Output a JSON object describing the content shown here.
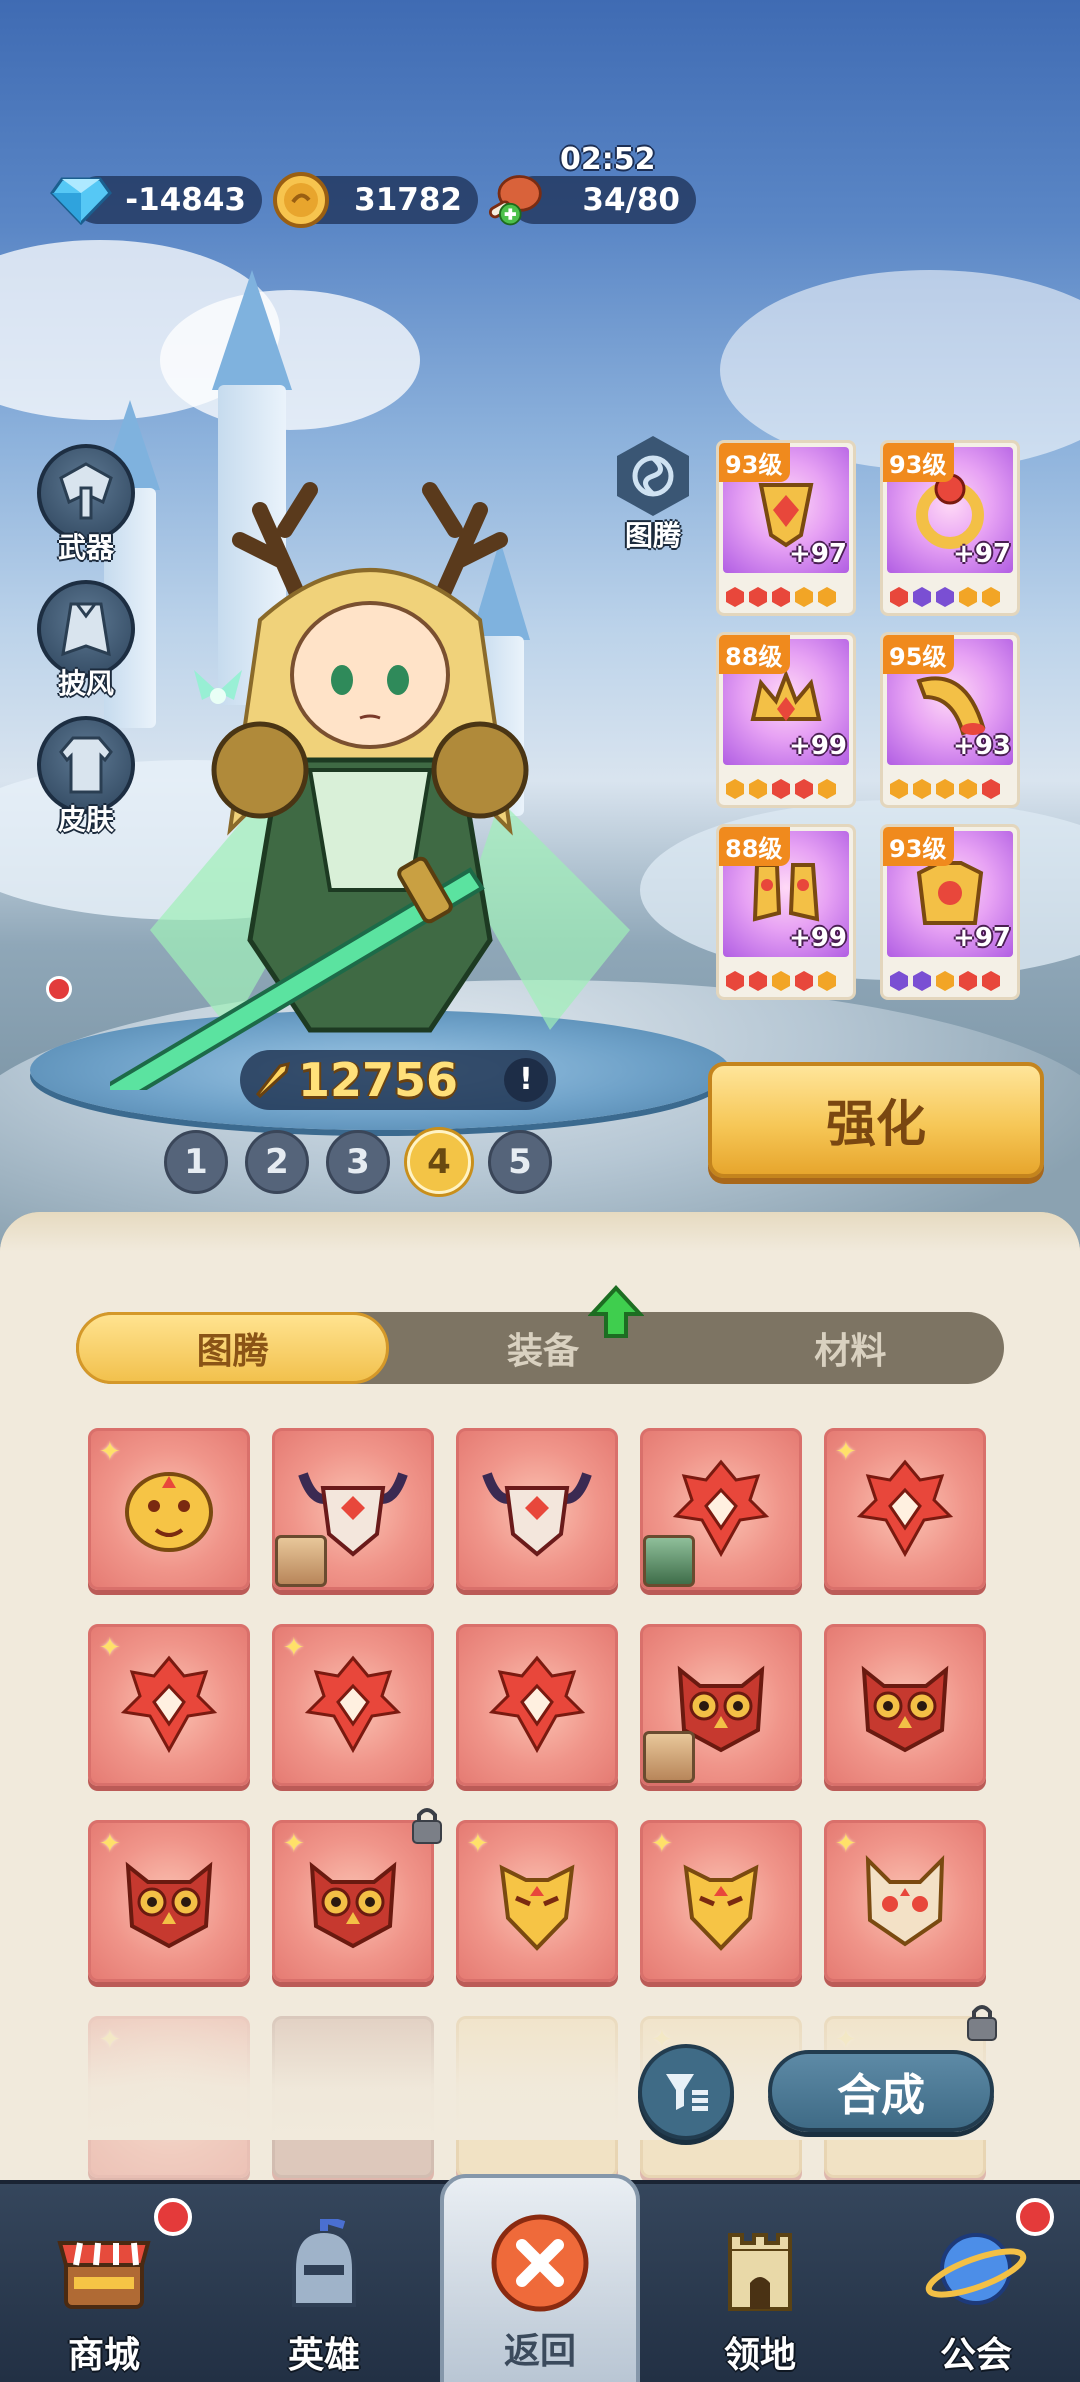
{
  "resources": {
    "timer": "02:52",
    "diamonds": "-14843",
    "gold": "31782",
    "stamina": "34/80"
  },
  "side_buttons": [
    {
      "label": "武器",
      "icon": "weapon-icon"
    },
    {
      "label": "披风",
      "icon": "cape-icon"
    },
    {
      "label": "皮肤",
      "icon": "skin-icon"
    }
  ],
  "hero": {
    "power": "12756",
    "info_mark": "!",
    "pages": [
      "1",
      "2",
      "3",
      "4",
      "5"
    ],
    "active_page": "4"
  },
  "totem_button": {
    "label": "图腾",
    "icon": "totem-icon"
  },
  "equipment": [
    {
      "level": "93级",
      "plus": "+97",
      "gems": [
        "#e8473b",
        "#e8473b",
        "#e8473b",
        "#f2a526",
        "#f2a526"
      ]
    },
    {
      "level": "93级",
      "plus": "+97",
      "gems": [
        "#e8473b",
        "#7a4fd3",
        "#7a4fd3",
        "#f2a526",
        "#f2a526"
      ]
    },
    {
      "level": "88级",
      "plus": "+99",
      "gems": [
        "#f2a526",
        "#f2a526",
        "#e8473b",
        "#e8473b",
        "#f2a526"
      ]
    },
    {
      "level": "95级",
      "plus": "+93",
      "gems": [
        "#f2a526",
        "#f2a526",
        "#f2a526",
        "#f2a526",
        "#e8473b"
      ]
    },
    {
      "level": "88级",
      "plus": "+99",
      "gems": [
        "#e8473b",
        "#e8473b",
        "#f2a526",
        "#e8473b",
        "#f2a526"
      ]
    },
    {
      "level": "93级",
      "plus": "+97",
      "gems": [
        "#7a4fd3",
        "#7a4fd3",
        "#f2a526",
        "#e8473b",
        "#e8473b"
      ]
    }
  ],
  "strengthen_button": "强化",
  "tabs": [
    {
      "label": "图腾",
      "active": true
    },
    {
      "label": "装备",
      "active": false
    },
    {
      "label": "材料",
      "active": false
    }
  ],
  "totem_grid": [
    {
      "icon": "tiger-mask-icon",
      "star": true,
      "avatar": false,
      "lock": false
    },
    {
      "icon": "skull-mask-icon",
      "star": false,
      "avatar": true,
      "lock": false
    },
    {
      "icon": "skull-mask-icon",
      "star": false,
      "avatar": false,
      "lock": false
    },
    {
      "icon": "phoenix-mask-icon",
      "star": false,
      "avatar": true,
      "lock": false
    },
    {
      "icon": "phoenix-mask-icon",
      "star": true,
      "avatar": false,
      "lock": false
    },
    {
      "icon": "phoenix-mask-icon",
      "star": true,
      "avatar": false,
      "lock": false
    },
    {
      "icon": "phoenix-mask-icon",
      "star": true,
      "avatar": false,
      "lock": false
    },
    {
      "icon": "phoenix-mask-icon",
      "star": false,
      "avatar": false,
      "lock": false
    },
    {
      "icon": "owl-mask-icon",
      "star": false,
      "avatar": true,
      "lock": false
    },
    {
      "icon": "owl-mask-icon",
      "star": false,
      "avatar": false,
      "lock": false
    },
    {
      "icon": "owl-mask-icon",
      "star": true,
      "avatar": false,
      "lock": false
    },
    {
      "icon": "owl-mask-icon",
      "star": true,
      "avatar": false,
      "lock": true
    },
    {
      "icon": "dragon-mask-icon",
      "star": true,
      "avatar": false,
      "lock": false
    },
    {
      "icon": "dragon-mask-icon",
      "star": true,
      "avatar": false,
      "lock": false
    },
    {
      "icon": "cat-mask-icon",
      "star": true,
      "avatar": false,
      "lock": false
    }
  ],
  "actions": {
    "synthesize": "合成",
    "filter_icon": "filter-icon"
  },
  "nav": [
    {
      "label": "商城",
      "icon": "shop-icon",
      "badge": true
    },
    {
      "label": "英雄",
      "icon": "hero-helmet-icon",
      "badge": false
    },
    {
      "label": "返回",
      "icon": "close-icon",
      "badge": false,
      "active": true
    },
    {
      "label": "领地",
      "icon": "castle-icon",
      "badge": false
    },
    {
      "label": "公会",
      "icon": "planet-icon",
      "badge": true
    }
  ]
}
